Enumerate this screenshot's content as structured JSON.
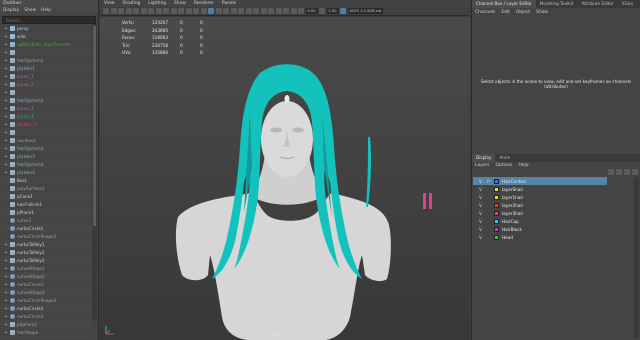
{
  "outliner": {
    "title": "Outliner",
    "menu": [
      "Display",
      "Show",
      "Help"
    ],
    "search_placeholder": "Search...",
    "items": [
      {
        "label": "persp",
        "color": "#9fd3ff",
        "icon": "camera-icon",
        "exp": "+"
      },
      {
        "label": "side",
        "color": "#cfcfcf",
        "icon": "camera-icon",
        "exp": "+"
      },
      {
        "label": "ngSkinTools_DataTransfer",
        "color": "#46a846",
        "icon": "node-icon",
        "exp": "+"
      },
      {
        "label": "",
        "color": "#cfcfcf",
        "icon": "mesh-icon",
        "exp": "+"
      },
      {
        "label": "hairSystem1",
        "color": "#8fa6b3",
        "icon": "mesh-icon",
        "exp": "+"
      },
      {
        "label": "pfxHair1",
        "color": "#8fa6b3",
        "icon": "mesh-icon",
        "exp": "+"
      },
      {
        "label": "curve_1",
        "color": "#c65bc6",
        "icon": "mesh-icon",
        "exp": "+"
      },
      {
        "label": "curve_2",
        "color": "#c65bc6",
        "icon": "mesh-icon",
        "exp": "+"
      },
      {
        "label": "",
        "color": "#cfcfcf",
        "icon": "mesh-icon",
        "exp": "+"
      },
      {
        "label": "hairSystem2",
        "color": "#8fa6b3",
        "icon": "mesh-icon",
        "exp": "+"
      },
      {
        "label": "curve_3",
        "color": "#c65bc6",
        "icon": "mesh-icon",
        "exp": "+"
      },
      {
        "label": "curve_4",
        "color": "#46a846",
        "icon": "mesh-icon",
        "exp": "+"
      },
      {
        "label": "pfxHair_2",
        "color": "#e0427a",
        "icon": "mesh-icon",
        "exp": "+"
      },
      {
        "label": "",
        "color": "#cfcfcf",
        "icon": "mesh-icon",
        "exp": "+"
      },
      {
        "label": "nucleus1",
        "color": "#8fa6b3",
        "icon": "nucleus-icon",
        "exp": "+"
      },
      {
        "label": "hairSystem3",
        "color": "#8fa6b3",
        "icon": "mesh-icon",
        "exp": "+"
      },
      {
        "label": "pfxHair3",
        "color": "#8fa6b3",
        "icon": "mesh-icon",
        "exp": "+"
      },
      {
        "label": "hairSystem4",
        "color": "#8fa6b3",
        "icon": "mesh-icon",
        "exp": "+"
      },
      {
        "label": "pfxHair4",
        "color": "#8fa6b3",
        "icon": "mesh-icon",
        "exp": "+"
      },
      {
        "label": "Bust",
        "color": "#cfcfcf",
        "icon": "mesh-icon",
        "exp": ""
      },
      {
        "label": "polySurface1",
        "color": "#8fa6b3",
        "icon": "mesh-icon",
        "exp": ""
      },
      {
        "label": "pCone1",
        "color": "#cfcfcf",
        "icon": "mesh-icon",
        "exp": ""
      },
      {
        "label": "hairFollicle1",
        "color": "#cfcfcf",
        "icon": "mesh-icon",
        "exp": ""
      },
      {
        "label": "pPlane1",
        "color": "#cfcfcf",
        "icon": "mesh-icon",
        "exp": ""
      },
      {
        "label": "curve1",
        "color": "#8fa6b3",
        "icon": "curve-icon",
        "exp": ""
      },
      {
        "label": "nurbsCircle1",
        "color": "#cfcfcf",
        "icon": "curve-icon",
        "exp": ""
      },
      {
        "label": "nurbsCircleShape1",
        "color": "#8fa6b3",
        "icon": "curve-icon",
        "exp": ""
      },
      {
        "label": "nurbsToPoly1",
        "color": "#cfcfcf",
        "icon": "mesh-icon",
        "exp": "+"
      },
      {
        "label": "nurbsToPoly2",
        "color": "#cfcfcf",
        "icon": "mesh-icon",
        "exp": "+"
      },
      {
        "label": "nurbsToPoly3",
        "color": "#cfcfcf",
        "icon": "mesh-icon",
        "exp": "+"
      },
      {
        "label": "curveShape1",
        "color": "#8fa6b3",
        "icon": "curve-icon",
        "exp": "+"
      },
      {
        "label": "curveShape2",
        "color": "#8fa6b3",
        "icon": "curve-icon",
        "exp": "+"
      },
      {
        "label": "nurbsCurve1",
        "color": "#8fa6b3",
        "icon": "curve-icon",
        "exp": "+"
      },
      {
        "label": "curveShape3",
        "color": "#8fa6b3",
        "icon": "curve-icon",
        "exp": "+"
      },
      {
        "label": "nurbsCircleShape2",
        "color": "#8fa6b3",
        "icon": "curve-icon",
        "exp": "+"
      },
      {
        "label": "nurbsCircle2",
        "color": "#cfcfcf",
        "icon": "curve-icon",
        "exp": "+"
      },
      {
        "label": "nurbsCircle3",
        "color": "#8fa6b3",
        "icon": "curve-icon",
        "exp": "+"
      },
      {
        "label": "pSphere2",
        "color": "#8fa6b3",
        "icon": "mesh-icon",
        "exp": "+"
      },
      {
        "label": "hairShape",
        "color": "#8fa6b3",
        "icon": "mesh-icon",
        "exp": "+"
      },
      {
        "label": "pCube1",
        "color": "#8fa6b3",
        "icon": "mesh-icon",
        "exp": "+"
      }
    ]
  },
  "viewport": {
    "menu": [
      "View",
      "Shading",
      "Lighting",
      "Show",
      "Renderer",
      "Panels"
    ],
    "toolbar": {
      "field_1": "0.00",
      "field_2": "1.00",
      "colorspace": "ACES 1.0 SDR-vid"
    },
    "hud": [
      {
        "name": "Verts:",
        "v1": "124207",
        "v2": "0",
        "v3": "0"
      },
      {
        "name": "Edges:",
        "v1": "243695",
        "v2": "0",
        "v3": "0"
      },
      {
        "name": "Faces:",
        "v1": "118093",
        "v2": "0",
        "v3": "0"
      },
      {
        "name": "Tris:",
        "v1": "236758",
        "v2": "0",
        "v3": "0"
      },
      {
        "name": "UVs:",
        "v1": "135866",
        "v2": "0",
        "v3": "0"
      }
    ],
    "camera_label": "persp",
    "colors": {
      "hair": "#14c2bd",
      "bust": "#d9d9d9",
      "pink": "#e0428a"
    }
  },
  "right_panel": {
    "tabs": [
      "Channel Box / Layer Editor",
      "Modeling Toolkit",
      "Attribute Editor",
      "XGen"
    ],
    "channel_menu": [
      "Channels",
      "Edit",
      "Object",
      "Show"
    ],
    "empty_message_1": "Select objects in the scene to view, edit and set keyframes on channels",
    "empty_message_2": "(attributes)",
    "layer_tabs": [
      "Display",
      "Anim"
    ],
    "layer_menu": [
      "Layers",
      "Options",
      "Help"
    ],
    "layers": [
      {
        "name": "HairControl",
        "v": "V",
        "p": "P",
        "color": "#3f6fd6",
        "selected": true
      },
      {
        "name": "layerShair",
        "v": "V",
        "p": "",
        "color": "#cde84a",
        "selected": false
      },
      {
        "name": "layer1hair",
        "v": "V",
        "p": "",
        "color": "#ffd01a",
        "selected": false
      },
      {
        "name": "layer2hair",
        "v": "V",
        "p": "",
        "color": "#e83a3a",
        "selected": false
      },
      {
        "name": "layer3hair",
        "v": "V",
        "p": "",
        "color": "#e8427a",
        "selected": false
      },
      {
        "name": "HairCap",
        "v": "V",
        "p": "",
        "color": "#33c6e8",
        "selected": false
      },
      {
        "name": "HairBlock",
        "v": "V",
        "p": "",
        "color": "#c03cc6",
        "selected": false
      },
      {
        "name": "Head",
        "v": "V",
        "p": "",
        "color": "#2fcf3c",
        "selected": false
      }
    ]
  }
}
